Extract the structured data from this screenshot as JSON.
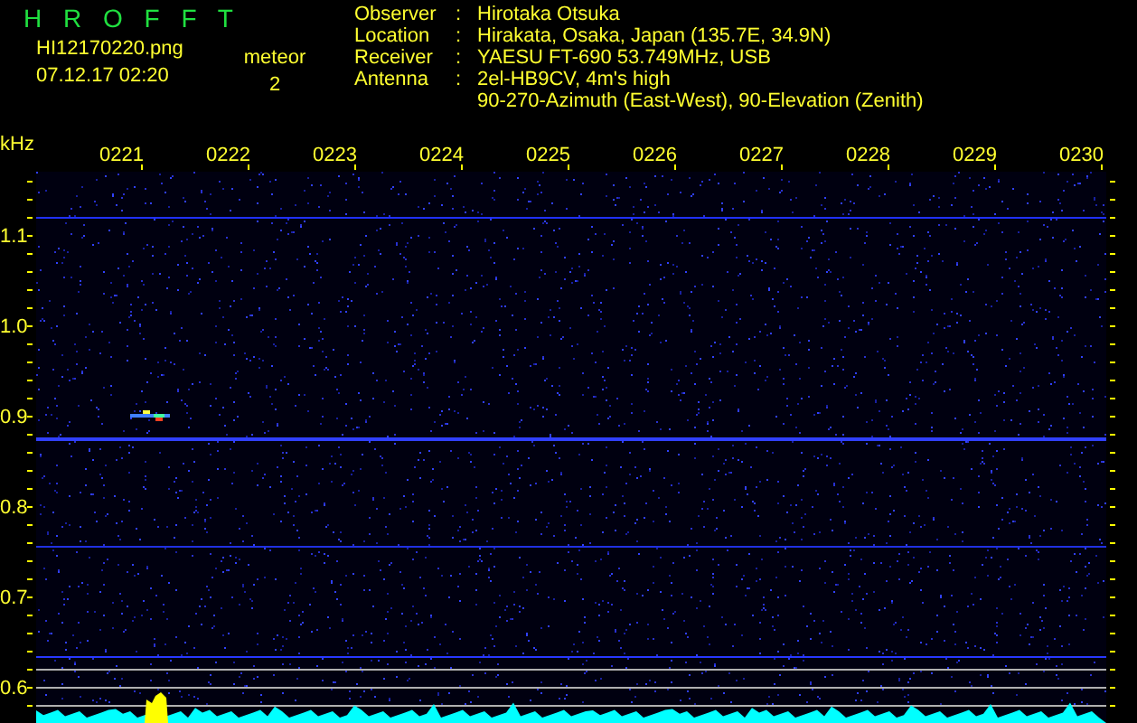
{
  "app_title": "H R O F F T",
  "file_name": "HI12170220.png",
  "timestamp": "07.12.17 02:20",
  "counter": {
    "label": "meteor",
    "value": "2"
  },
  "info": [
    {
      "label": "Observer",
      "separator": ":",
      "lines": [
        "Hirotaka Otsuka"
      ]
    },
    {
      "label": "Location",
      "separator": ":",
      "lines": [
        "Hirakata, Osaka, Japan (135.7E, 34.9N)"
      ]
    },
    {
      "label": "Receiver",
      "separator": ":",
      "lines": [
        "YAESU FT-690 53.749MHz, USB"
      ]
    },
    {
      "label": "Antenna",
      "separator": ":",
      "lines": [
        "2el-HB9CV, 4m's high",
        "90-270-Azimuth (East-West), 90-Elevation (Zenith)"
      ]
    }
  ],
  "y_unit": "kHz",
  "time_labels": [
    "0221",
    "0222",
    "0223",
    "0224",
    "0225",
    "0226",
    "0227",
    "0228",
    "0229",
    "0230"
  ],
  "freq_labels": [
    "1.1",
    "1.0",
    "0.9",
    "0.8",
    "0.7",
    "0.6"
  ]
}
